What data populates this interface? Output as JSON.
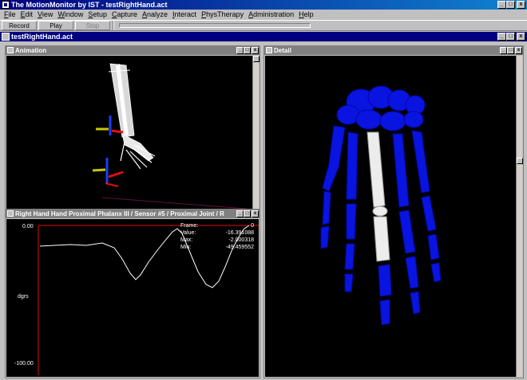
{
  "app": {
    "title": "The MotionMonitor by IST - testRightHand.act",
    "window_buttons": [
      "_",
      "□",
      "x"
    ]
  },
  "menu": {
    "items": [
      "File",
      "Edit",
      "View",
      "Window",
      "Setup",
      "Capture",
      "Analyze",
      "Interact",
      "PhysTherapy",
      "Administration",
      "Help"
    ]
  },
  "toolbar": {
    "record_label": "Record",
    "play_label": "Play",
    "stop_label": "Stop"
  },
  "document": {
    "title": "testRightHand.act"
  },
  "panels": {
    "animation": {
      "title": "Animation"
    },
    "detail": {
      "title": "Detail"
    },
    "graph": {
      "title": "Right Hand Hand Proximal Phalanx III / Sensor #5 / Proximal Joint / R",
      "y_max_label": "0.00",
      "y_min_label": "-100.00",
      "y_unit_label": "dgrs",
      "stats": {
        "frame_label": "Frame:",
        "frame_value": "0",
        "value_label": "Value:",
        "value_value": "-16.391088",
        "max_label": "Max:",
        "max_value": "-2.000318",
        "min_label": "Min:",
        "min_value": "-49.459552"
      }
    }
  },
  "colors": {
    "title_active": "#000080",
    "bone_blue": "#0a14e0",
    "bone_white": "#ececec",
    "graph_cursor": "#e01010"
  }
}
